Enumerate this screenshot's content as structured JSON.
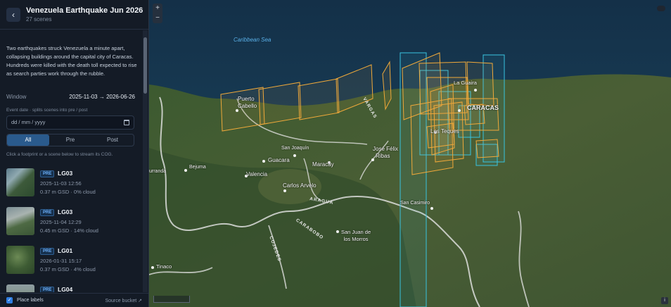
{
  "sidebar": {
    "back_icon": "chevron-left-icon",
    "title": "Venezuela Earthquake Jun 2026",
    "subtitle": "27 scenes",
    "description": "Two earthquakes struck Venezuela a minute apart, collapsing buildings around the capital city of Caracas. Hundreds were killed with the death toll expected to rise as search parties work through the rubble.",
    "window_label": "Window",
    "window_value": "2025-11-03 → 2026-06-26",
    "event_date_label": "Event date",
    "event_date_hint": "splits scenes into pre / post",
    "date_placeholder": "dd / mm / yyyy",
    "filters": [
      "All",
      "Pre",
      "Post"
    ],
    "active_filter": "All",
    "footprint_hint": "Click a footprint or a scene below to stream its COG.",
    "scenes": [
      {
        "badge": "PRE",
        "name": "LG03",
        "time": "2025-11-03 12:56",
        "meta": "0.37 m GSD · 0% cloud"
      },
      {
        "badge": "PRE",
        "name": "LG03",
        "time": "2025-11-04 12:29",
        "meta": "0.45 m GSD · 14% cloud"
      },
      {
        "badge": "PRE",
        "name": "LG01",
        "time": "2026-01-31 15:17",
        "meta": "0.37 m GSD · 4% cloud"
      },
      {
        "badge": "PRE",
        "name": "LG04",
        "time": "",
        "meta": ""
      }
    ],
    "footer": {
      "place_labels": "Place labels",
      "source": "Source bucket ↗"
    }
  },
  "map": {
    "labels": {
      "sea": "Caribbean Sea",
      "puerto_cabello_1": "Puerto",
      "puerto_cabello_2": "Cabello",
      "la_guaira": "La Guaira",
      "caracas": "CARACAS",
      "los_teques": "Los Teques",
      "san_joaquin": "San Joaquín",
      "guacara": "Guacara",
      "maracay": "Maracay",
      "jose_felix_1": "José Félix",
      "jose_felix_2": "Ribas",
      "valencia": "Valencia",
      "bejuma": "Bejuma",
      "miranda": "Miranda",
      "carlos_arvelo": "Carlos Arvelo",
      "san_casimiro": "San Casimiro",
      "san_juan_1": "San Juan de",
      "san_juan_2": "los Morros",
      "tinaco": "Tinaco",
      "aragua": "ARAGUA",
      "carabobo": "CARABOBO",
      "cojedes": "COJEDES",
      "vargas": "VARGAS"
    },
    "zoom_in": "+",
    "zoom_out": "−",
    "info": "i",
    "colors": {
      "pre_footprint": "#f0a93a",
      "post_footprint": "#38c3e0",
      "land": "#3a4a2a",
      "sea": "#17364f"
    }
  }
}
